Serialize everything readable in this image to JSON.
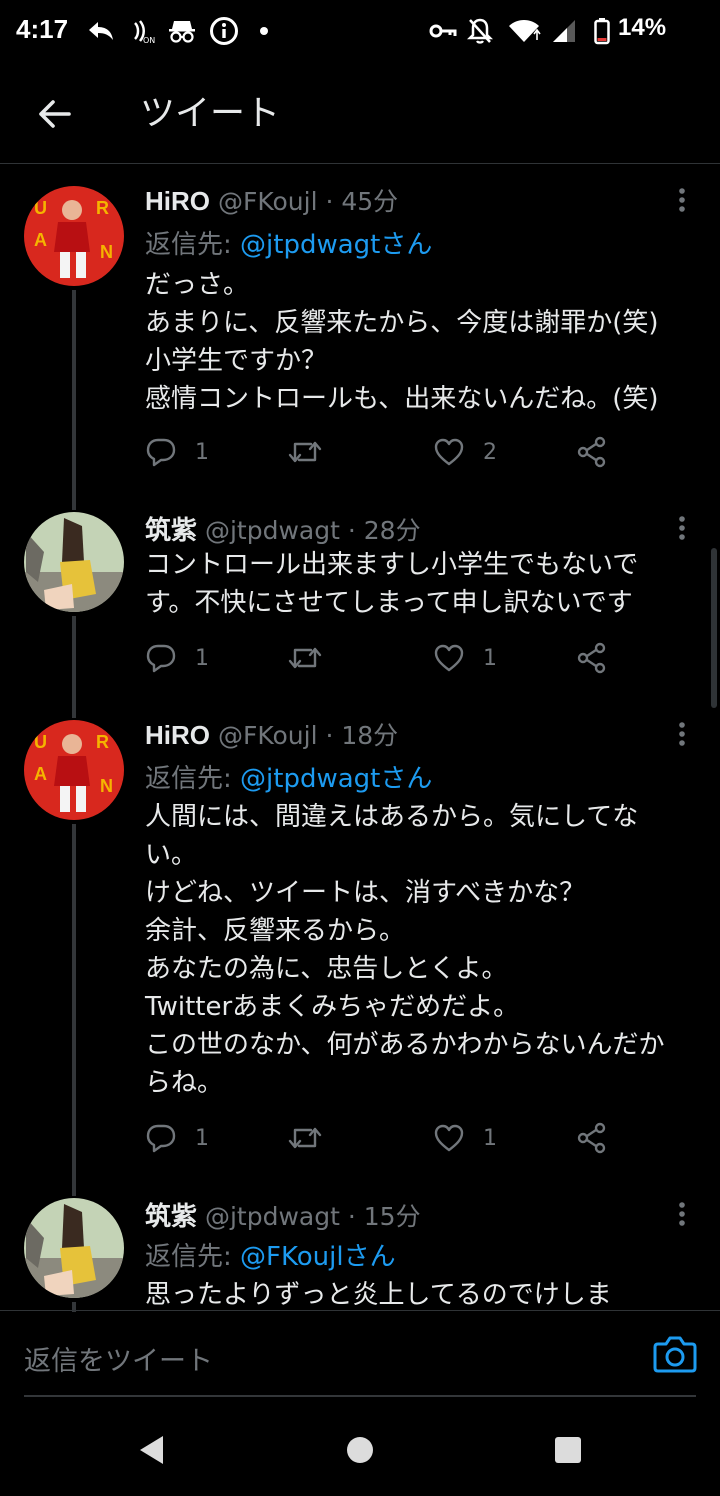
{
  "status_bar": {
    "time": "4:17",
    "battery": "14%",
    "icons": [
      "reply-arrow-icon",
      "nfc-on-icon",
      "incognito-icon",
      "info-icon",
      "dot-icon",
      "vpn-key-icon",
      "bell-off-icon",
      "wifi-icon",
      "signal-icon",
      "battery-icon"
    ]
  },
  "header": {
    "title": "ツイート"
  },
  "tweets": [
    {
      "name": "HiRO",
      "handle": "@FKoujl",
      "time": "· 45分",
      "reply_prefix": "返信先:",
      "reply_to": "@jtpdwagtさん",
      "text": "だっさ。\nあまりに、反響来たから、今度は謝罪か(笑)\n小学生ですか？\n感情コントロールも、出来ないんだね。(笑)",
      "replies": "1",
      "retweets": "",
      "likes": "2"
    },
    {
      "name": "筑紫",
      "handle": "@jtpdwagt",
      "time": "· 28分",
      "text": "コントロール出来ますし小学生でもないです。不快にさせてしまって申し訳ないです",
      "replies": "1",
      "retweets": "",
      "likes": "1"
    },
    {
      "name": "HiRO",
      "handle": "@FKoujl",
      "time": "· 18分",
      "reply_prefix": "返信先:",
      "reply_to": "@jtpdwagtさん",
      "text": "人間には、間違えはあるから。気にしてない。\nけどね、ツイートは、消すべきかな？\n余計、反響来るから。\nあなたの為に、忠告しとくよ。\nTwitterあまくみちゃだめだよ。\nこの世のなか、何があるかわからないんだからね。",
      "replies": "1",
      "retweets": "",
      "likes": "1"
    },
    {
      "name": "筑紫",
      "handle": "@jtpdwagt",
      "time": "· 15分",
      "reply_prefix": "返信先:",
      "reply_to": "@FKoujlさん",
      "text": "思ったよりずっと炎上してるのでけしま"
    }
  ],
  "reply_bar": {
    "placeholder": "返信をツイート"
  },
  "colors": {
    "accent": "#1d9bf0",
    "muted": "#71767b",
    "text": "#e7e9ea",
    "background": "#000000"
  }
}
